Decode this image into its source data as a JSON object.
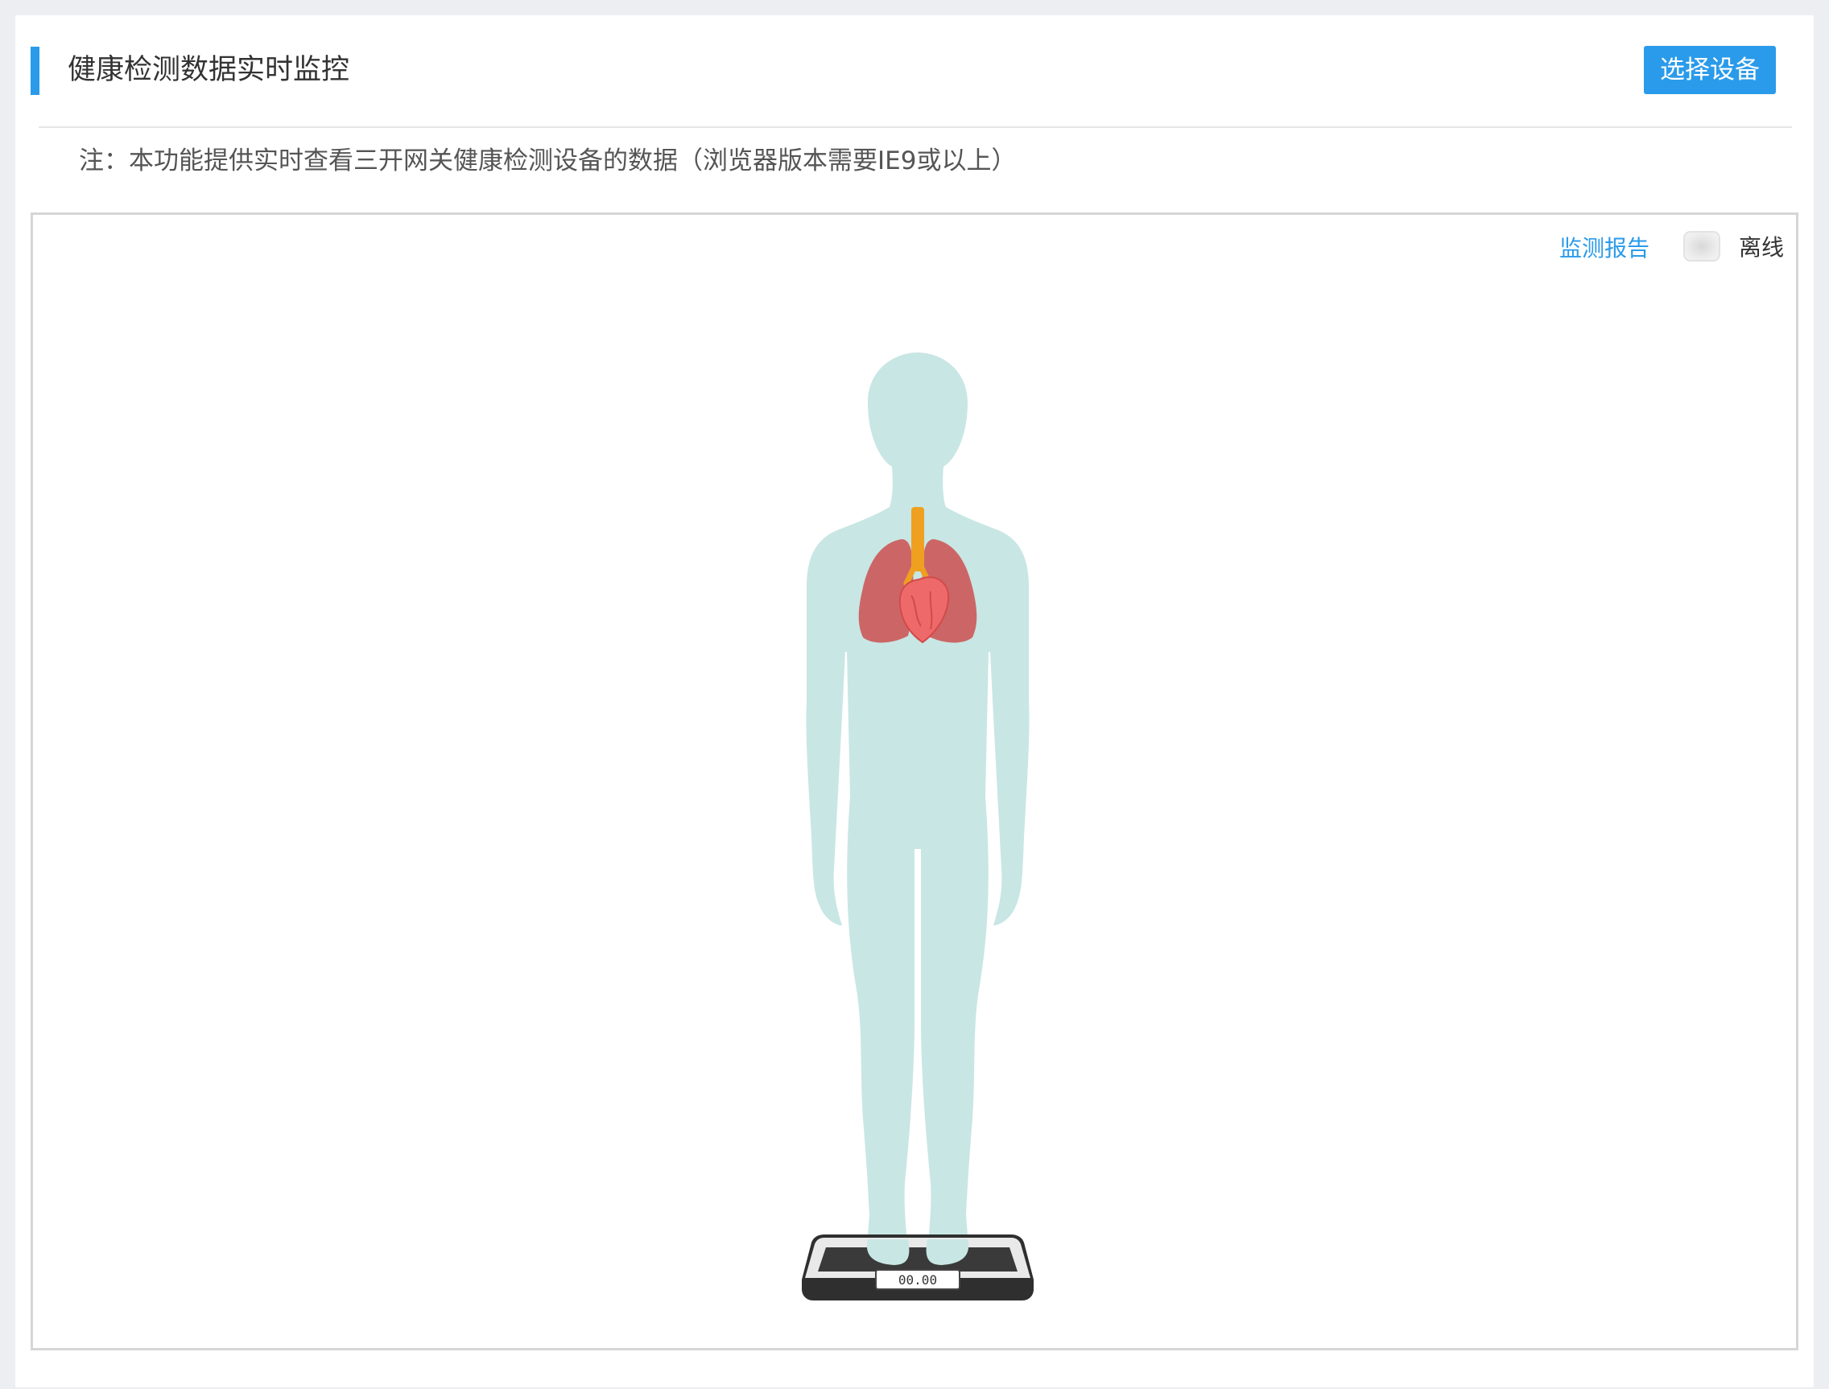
{
  "header": {
    "title": "健康检测数据实时监控",
    "select_device_label": "选择设备"
  },
  "note": "注：本功能提供实时查看三开网关健康检测设备的数据（浏览器版本需要IE9或以上）",
  "monitor": {
    "report_link_label": "监测报告",
    "status_label": "离线",
    "scale_reading": "00.00"
  },
  "colors": {
    "accent": "#2a9bea",
    "body": "#c8e6e4",
    "lungs": "#cc6666",
    "heart": "#ee6a6a",
    "trachea": "#f0a020"
  }
}
